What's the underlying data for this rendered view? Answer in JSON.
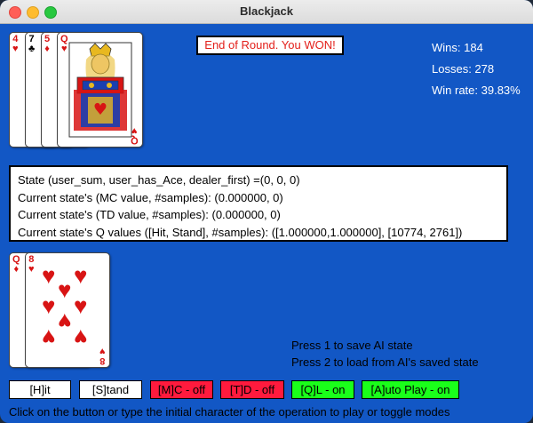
{
  "window": {
    "title": "Blackjack"
  },
  "result_message": "End of Round. You WON!",
  "stats": {
    "wins": "Wins: 184",
    "losses": "Losses: 278",
    "win_rate": "Win rate: 39.83%"
  },
  "dealer_cards": [
    {
      "rank": "4",
      "suit": "♥",
      "color": "red"
    },
    {
      "rank": "7",
      "suit": "♣",
      "color": "black"
    },
    {
      "rank": "5",
      "suit": "♦",
      "color": "red"
    },
    {
      "rank": "Q",
      "suit": "♥",
      "color": "red"
    }
  ],
  "player_cards": [
    {
      "rank": "Q",
      "suit": "♦",
      "color": "red"
    },
    {
      "rank": "8",
      "suit": "♥",
      "color": "red"
    }
  ],
  "state_box": {
    "line1": "State (user_sum, user_has_Ace, dealer_first) =(0, 0, 0)",
    "line2": "Current state's (MC value, #samples): (0.000000, 0)",
    "line3": "Current state's (TD value, #samples): (0.000000, 0)",
    "line4": "Current state's Q values ([Hit, Stand], #samples): ([1.000000,1.000000], [10774, 2761])"
  },
  "ai_info": {
    "save": "Press 1 to save AI state",
    "load": "Press 2 to load from AI's saved state"
  },
  "buttons": {
    "hit": "[H]it",
    "stand": "[S]tand",
    "mc": "[M]C - off",
    "td": "[T]D - off",
    "ql": "[Q]L - on",
    "auto": "[A]uto Play - on"
  },
  "colors": {
    "background": "#1257c5",
    "off": "#ff1a3d",
    "on": "#1aff1a",
    "result_text": "#e3201b"
  },
  "footer_hint": "Click on the button or type the initial character of the operation to play or toggle modes"
}
